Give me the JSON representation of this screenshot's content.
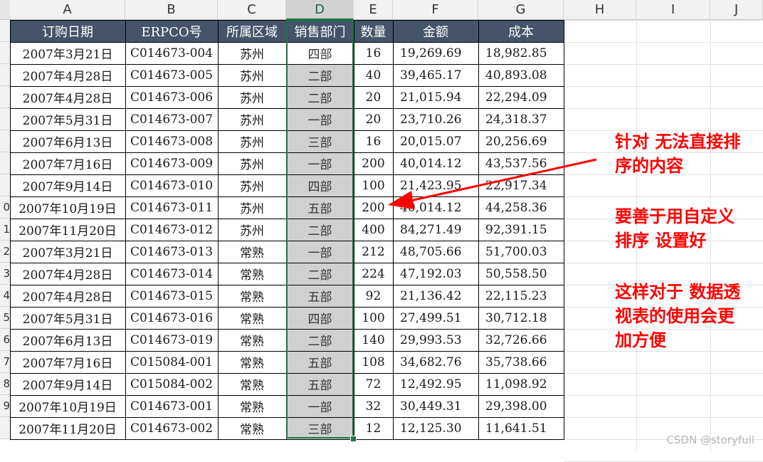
{
  "columns": [
    "A",
    "B",
    "C",
    "D",
    "E",
    "F",
    "G",
    "H",
    "I",
    "J"
  ],
  "selected_column": "D",
  "row_numbers": [
    "",
    "",
    "",
    "",
    "",
    "",
    "",
    "",
    "0",
    "1",
    "2",
    "3",
    "4",
    "5",
    "6",
    "7",
    "8",
    "9",
    ""
  ],
  "table": {
    "headers": [
      "订购日期",
      "ERPCO号",
      "所属区域",
      "销售部门",
      "数量",
      "金额",
      "成本"
    ],
    "rows": [
      [
        "2007年3月21日",
        "C014673-004",
        "苏州",
        "四部",
        "16",
        "19,269.69",
        "18,982.85"
      ],
      [
        "2007年4月28日",
        "C014673-005",
        "苏州",
        "二部",
        "40",
        "39,465.17",
        "40,893.08"
      ],
      [
        "2007年4月28日",
        "C014673-006",
        "苏州",
        "二部",
        "20",
        "21,015.94",
        "22,294.09"
      ],
      [
        "2007年5月31日",
        "C014673-007",
        "苏州",
        "一部",
        "20",
        "23,710.26",
        "24,318.37"
      ],
      [
        "2007年6月13日",
        "C014673-008",
        "苏州",
        "三部",
        "16",
        "20,015.07",
        "20,256.69"
      ],
      [
        "2007年7月16日",
        "C014673-009",
        "苏州",
        "一部",
        "200",
        "40,014.12",
        "43,537.56"
      ],
      [
        "2007年9月14日",
        "C014673-010",
        "苏州",
        "四部",
        "100",
        "21,423.95",
        "22,917.34"
      ],
      [
        "2007年10月19日",
        "C014673-011",
        "苏州",
        "五部",
        "200",
        "40,014.12",
        "44,258.36"
      ],
      [
        "2007年11月20日",
        "C014673-012",
        "苏州",
        "二部",
        "400",
        "84,271.49",
        "92,391.15"
      ],
      [
        "2007年3月21日",
        "C014673-013",
        "常熟",
        "一部",
        "212",
        "48,705.66",
        "51,700.03"
      ],
      [
        "2007年4月28日",
        "C014673-014",
        "常熟",
        "二部",
        "224",
        "47,192.03",
        "50,558.50"
      ],
      [
        "2007年4月28日",
        "C014673-015",
        "常熟",
        "五部",
        "92",
        "21,136.42",
        "22,115.23"
      ],
      [
        "2007年5月31日",
        "C014673-016",
        "常熟",
        "四部",
        "100",
        "27,499.51",
        "30,712.18"
      ],
      [
        "2007年6月13日",
        "C014673-019",
        "常熟",
        "二部",
        "140",
        "29,993.53",
        "32,726.66"
      ],
      [
        "2007年7月16日",
        "C015084-001",
        "常熟",
        "五部",
        "108",
        "34,682.76",
        "35,738.66"
      ],
      [
        "2007年9月14日",
        "C015084-002",
        "常熟",
        "五部",
        "72",
        "12,492.95",
        "11,098.92"
      ],
      [
        "2007年10月19日",
        "C014673-001",
        "常熟",
        "一部",
        "32",
        "30,449.31",
        "29,398.00"
      ],
      [
        "2007年11月20日",
        "C014673-002",
        "常熟",
        "三部",
        "12",
        "12,125.30",
        "11,641.51"
      ]
    ]
  },
  "annotations": {
    "a1": "针对 无法直接排\n序的内容",
    "a2": "要善于用自定义\n排序 设置好",
    "a3": "这样对于 数据透\n视表的使用会更\n加方便"
  },
  "watermark": "CSDN @storyfull",
  "colors": {
    "header_bg": "#44546a",
    "dept_fill": "#d0d0d0",
    "selection": "#217346",
    "annotation": "#ff0000"
  }
}
